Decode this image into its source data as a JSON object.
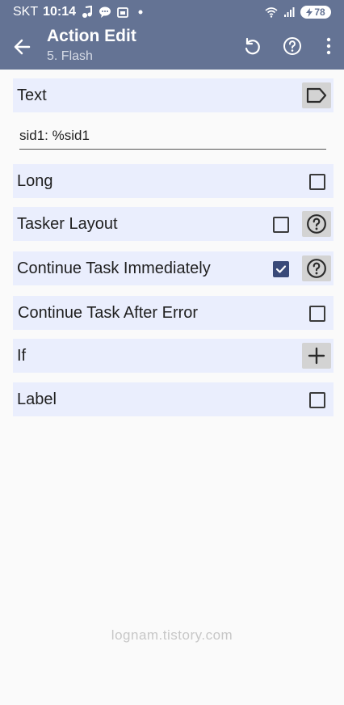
{
  "status": {
    "carrier": "SKT",
    "time": "10:14",
    "left_icons": [
      "music-note-icon",
      "chat-bubble-icon",
      "calendar-icon",
      "dot-icon"
    ],
    "right_icons": [
      "wifi-icon",
      "signal-icon"
    ],
    "battery": "78",
    "battery_charging": true
  },
  "toolbar": {
    "title": "Action Edit",
    "subtitle": "5. Flash",
    "actions": [
      "back-arrow-icon",
      "undo-icon",
      "help-icon",
      "more-vertical-icon"
    ]
  },
  "fields": {
    "text": {
      "label": "Text",
      "value": "sid1: %sid1",
      "button_icon": "label-tag-icon"
    },
    "long": {
      "label": "Long",
      "checked": false
    },
    "tasker_layout": {
      "label": "Tasker Layout",
      "checked": false,
      "button_icon": "help-icon"
    },
    "continue_immediately": {
      "label": "Continue Task Immediately",
      "checked": true,
      "button_icon": "help-icon"
    },
    "continue_after_error": {
      "label": "Continue Task After Error",
      "checked": false
    },
    "if": {
      "label": "If",
      "button_icon": "plus-icon"
    },
    "label": {
      "label": "Label",
      "checked": false
    }
  },
  "watermark": "lognam.tistory.com",
  "colors": {
    "appbar": "#647394",
    "row_bg": "#eaeefd",
    "checked": "#3a4a79",
    "background": "#fafafa"
  }
}
